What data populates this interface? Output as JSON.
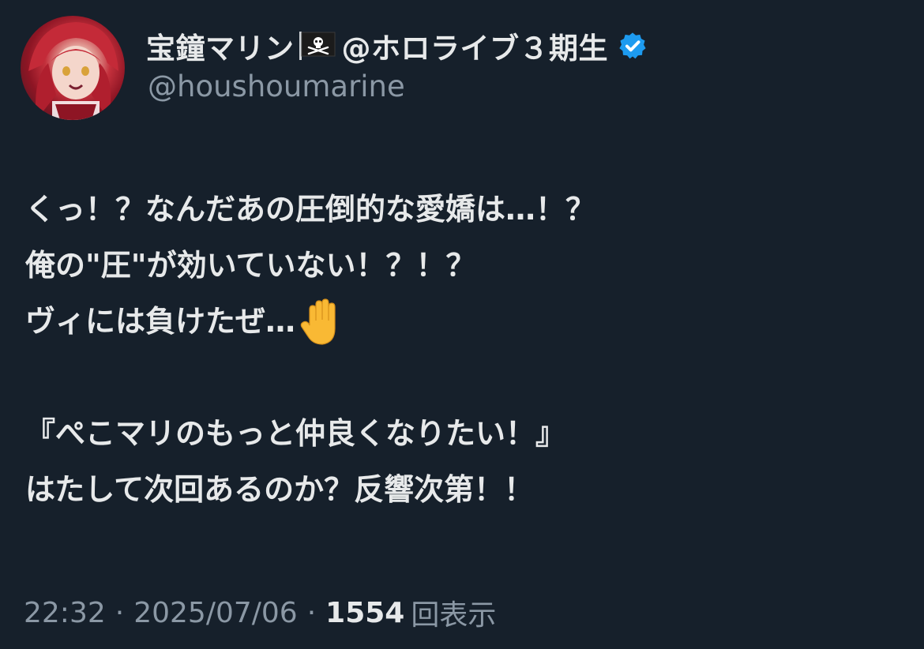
{
  "author": {
    "display_name_pre": "宝鐘マリン",
    "display_name_post": "@ホロライブ３期生",
    "flag_icon": "pirate-flag-icon",
    "verified_icon": "verified-badge-icon",
    "verified_color": "#1d9bf0",
    "handle": "@houshoumarine"
  },
  "tweet": {
    "lines": [
      "くっ！？なんだあの圧倒的な愛嬌は…！？",
      "俺の\"圧\"が効いていない！？！？",
      "ヴィには負けたぜ…",
      "",
      "『ぺこマリのもっと仲良くなりたい！』",
      "はたして次回あるのか？反響次第！！"
    ],
    "hand_emoji_icon": "raised-hand-icon"
  },
  "meta": {
    "time": "22:32",
    "separator": "·",
    "date": "2025/07/06",
    "views_count": "1554",
    "views_label": "回表示"
  }
}
